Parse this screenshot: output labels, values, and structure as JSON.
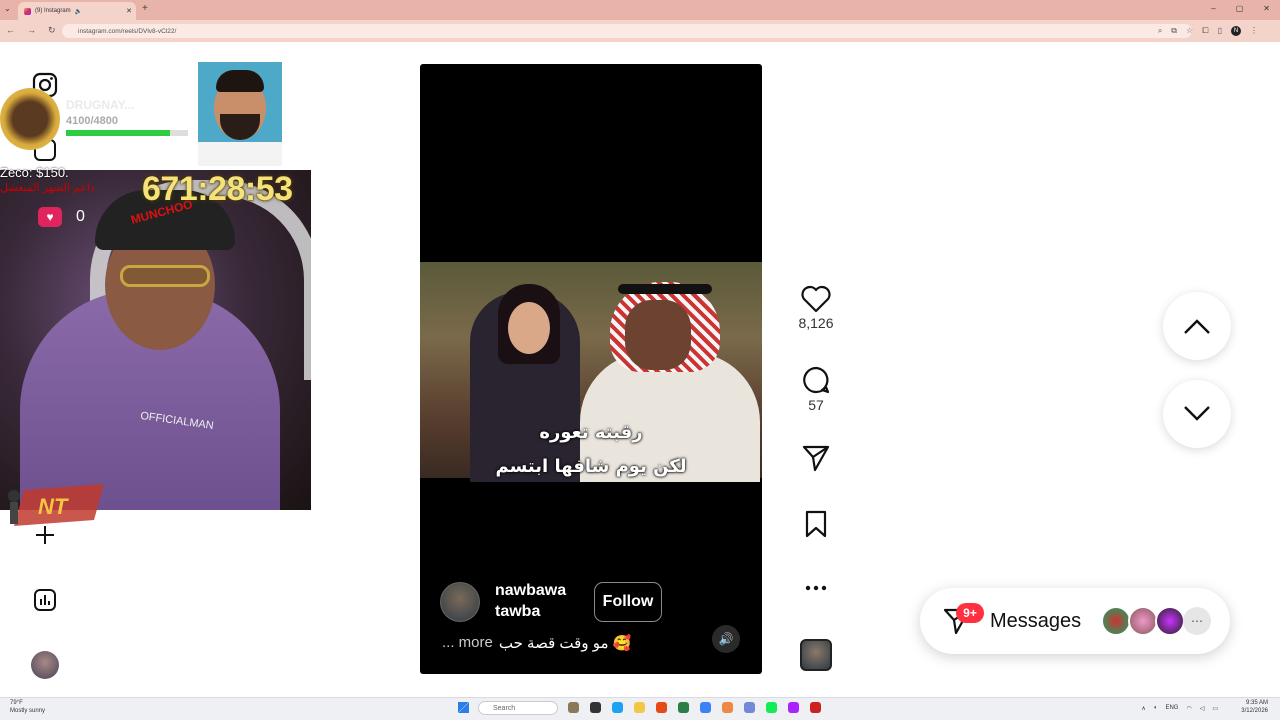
{
  "browser": {
    "tab_title": "(9) Instagram",
    "url": "instagram.com/reels/DVlv8-vCl22/",
    "new_tab": "+",
    "win_minimize": "–",
    "win_maximize": "▢",
    "win_close": "✕"
  },
  "stream_overlay": {
    "donation": "Zeco: $150.",
    "donation_subtext": "داعم الشهر المنعشل",
    "timer": "671:28:53",
    "heart_count": "0",
    "sub_goal_name": "DRUGNAY...",
    "sub_goal_progress": "4100/4800",
    "sub_goal_fraction": 0.85,
    "cap_text": "MUNCHOO",
    "hoodie_text": "OFFICIALMAN"
  },
  "reel": {
    "subtitle_line1": "رقبته تعوره",
    "subtitle_line2": "لكن يوم شافها ابتسم",
    "username_line1": "nawbawa",
    "username_line2": "tawba",
    "follow_label": "Follow",
    "caption": "مو وقت قصة حب 🥰",
    "caption_more": "... more"
  },
  "actions": {
    "likes": "8,126",
    "comments": "57"
  },
  "messages": {
    "label": "Messages",
    "badge": "9+"
  },
  "taskbar": {
    "weather_temp": "79°F",
    "weather_desc": "Mostly sunny",
    "search_placeholder": "Search",
    "lang": "ENG",
    "time": "9:35 AM",
    "date": "3/12/2026"
  },
  "colors": {
    "chrome_tab_bar": "#e8b3a8",
    "follow_border": "#8a8a8a",
    "badge_red": "#ff3040",
    "timer_yellow": "#f5e27a",
    "progress_green": "#2ecc40"
  }
}
